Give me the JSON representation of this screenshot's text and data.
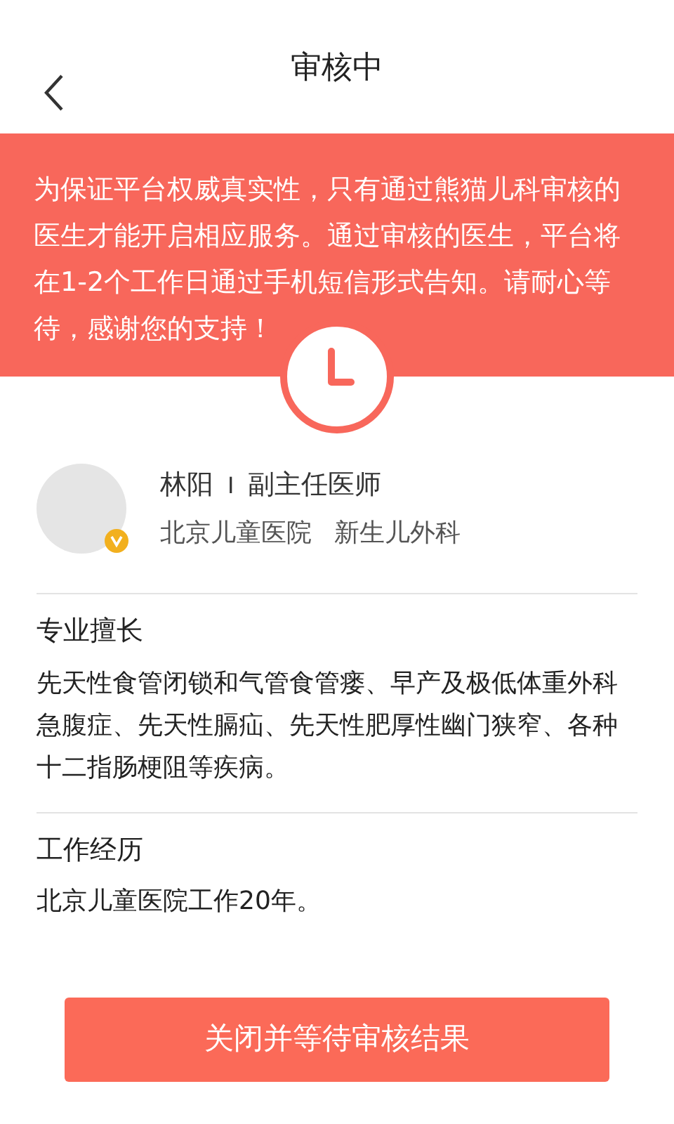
{
  "header": {
    "title": "审核中"
  },
  "notice": {
    "text": "为保证平台权威真实性，只有通过熊猫儿科审核的医生才能开启相应服务。通过审核的医生，平台将在1-2个工作日通过手机短信形式告知。请耐心等待，感谢您的支持！"
  },
  "doctor": {
    "name": "林阳",
    "separator": "I",
    "title": "副主任医师",
    "hospital": "北京儿童医院",
    "department": "新生儿外科",
    "verified": true
  },
  "sections": [
    {
      "heading": "专业擅长",
      "body": "先天性食管闭锁和气管食管瘘、早产及极低体重外科急腹症、先天性膈疝、先天性肥厚性幽门狭窄、各种十二指肠梗阻等疾病。"
    },
    {
      "heading": "工作经历",
      "body": "北京儿童医院工作20年。"
    }
  ],
  "button": {
    "label": "关闭并等待审核结果"
  }
}
